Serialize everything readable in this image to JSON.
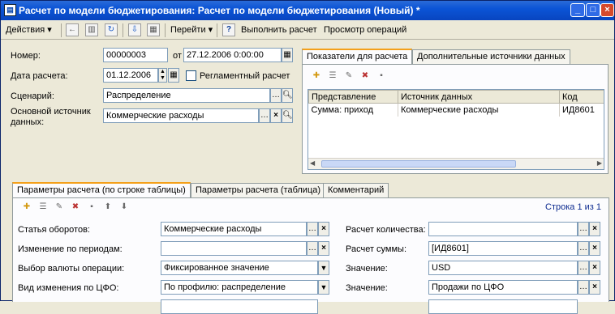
{
  "window": {
    "title": "Расчет по модели бюджетирования: Расчет по модели бюджетирования (Новый) *",
    "icon": "form-icon",
    "buttons": [
      "minimize",
      "maximize",
      "close"
    ]
  },
  "toolbar": {
    "actions_label": "Действия",
    "goto_label": "Перейти",
    "help_label": "?",
    "run_label": "Выполнить расчет",
    "view_ops_label": "Просмотр операций"
  },
  "header": {
    "number_label": "Номер:",
    "number_value": "00000003",
    "from_label": "от",
    "date_value": "27.12.2006  0:00:00",
    "calc_date_label": "Дата расчета:",
    "calc_date_value": "01.12.2006",
    "reglament_label": "Регламентный расчет",
    "scenario_label": "Сценарий:",
    "scenario_value": "Распределение",
    "main_source_label_1": "Основной источник",
    "main_source_label_2": "данных:",
    "main_source_value": "Коммерческие расходы"
  },
  "right_tabs": {
    "tabs": [
      "Показатели для расчета",
      "Дополнительные источники данных"
    ],
    "columns": [
      "Представление",
      "Источник данных",
      "Код"
    ],
    "rows": [
      [
        "Сумма: приход",
        "Коммерческие расходы",
        "ИД8601"
      ]
    ]
  },
  "bottom_tabs": {
    "tabs": [
      "Параметры расчета (по строке таблицы)",
      "Параметры расчета (таблица)",
      "Комментарий"
    ],
    "row_counter": "Строка 1 из 1",
    "left_fields": [
      {
        "label": "Статья оборотов:",
        "value": "Коммерческие расходы"
      },
      {
        "label": "Изменение по периодам:",
        "value": ""
      },
      {
        "label": "Выбор валюты операции:",
        "value": "Фиксированное значение"
      },
      {
        "label": "Вид изменения по ЦФО:",
        "value": "По профилю: распределение"
      }
    ],
    "right_fields": [
      {
        "label": "Расчет количества:",
        "value": ""
      },
      {
        "label": "Расчет суммы:",
        "value": "[ИД8601]"
      },
      {
        "label": "Значение:",
        "value": "USD"
      },
      {
        "label": "Значение:",
        "value": "Продажи по ЦФО"
      }
    ]
  }
}
